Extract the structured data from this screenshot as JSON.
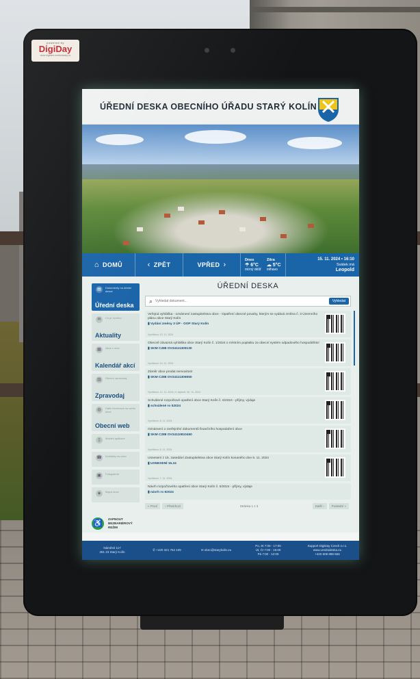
{
  "kiosk": {
    "sticker": {
      "brand_small": "powered by",
      "brand": "DigiDay",
      "brand_sub": "www.digitalni-urednidesky.cz"
    }
  },
  "screen": {
    "title": "ÚŘEDNÍ DESKA OBECNÍHO ÚŘADU STARÝ KOLÍN",
    "nav": {
      "home": "DOMŮ",
      "back": "ZPĚT",
      "forward": "VPŘED",
      "weather_today_day": "Dnes",
      "weather_today_temp": "6°C",
      "weather_today_desc": "mírný déšť",
      "weather_tomorrow_day": "Zítra",
      "weather_tomorrow_temp": "5°C",
      "weather_tomorrow_desc": "mlhavo",
      "datetime": "15. 11. 2024 • 16:10",
      "nameday": "Svátek má",
      "name": "Leopold"
    },
    "sidebar": [
      {
        "small": "Dokumenty na úřední desce",
        "label": "Úřední deska",
        "active": true,
        "icon": "document-icon"
      },
      {
        "small": "Co je nového",
        "label": "Aktuality",
        "active": false,
        "icon": "news-icon"
      },
      {
        "small": "Akce v obci",
        "label": "Kalendář akcí",
        "active": false,
        "icon": "calendar-icon"
      },
      {
        "small": "Obecní zpravodaj",
        "label": "Zpravodaj",
        "active": false,
        "icon": "newsletter-icon"
      },
      {
        "small": "Další informace na webu obce",
        "label": "Obecní web",
        "active": false,
        "icon": "globe-icon"
      },
      {
        "small": "Mobilní aplikace",
        "label": "",
        "active": false,
        "icon": "mobile-icon"
      },
      {
        "small": "Kontakty na obec",
        "label": "",
        "active": false,
        "icon": "contact-icon"
      },
      {
        "small": "Fotogalerie",
        "label": "",
        "active": false,
        "icon": "gallery-icon"
      },
      {
        "small": "Mapa obce",
        "label": "",
        "active": false,
        "icon": "map-icon"
      }
    ],
    "accessibility": "ZAPNOUT BEZBARIÉROVÝ REŽIM",
    "main": {
      "title": "ÚŘEDNÍ DESKA",
      "search_placeholder": "Vyhledat dokument...",
      "search_button": "Vyhledat",
      "documents": [
        {
          "title": "Veřejná vyhláška - oznámení zastupitelstva obce - Opatření obecné povahy, kterým se vydává změna č. 3 Územního plánu obce Starý Kolín",
          "file": "Vydání změny 3 ÚP - OOP Starý Kolín",
          "date": "Vyvěšeno: 13. 11. 2024"
        },
        {
          "title": "Obecně závazná vyhláška obce Starý Kolín č. 1/2024 o místním poplatku za obecní systém odpadového hospodářství",
          "file": "SKM C288 OV24111309130",
          "date": "Vyvěšeno: 13. 11. 2024"
        },
        {
          "title": "Záměr obce prodat nemovitost",
          "file": "SKM C288 OV24111306550",
          "date": "Vyvěšeno: 12. 11. 2024 | K sejmutí: 30. 11. 2024"
        },
        {
          "title": "Schválené rozpočtové opatření obce Starý Kolín č. 6/2024 - příjmy, výdaje",
          "file": "schválené ro 52024",
          "date": "Vyvěšeno: 8. 11. 2024"
        },
        {
          "title": "Oznámení o zveřejnění dokumentů finančního hospodaření obce",
          "file": "SKM C288 OV24110810450",
          "date": "Vyvěšeno: 8. 11. 2024"
        },
        {
          "title": "Usnesení z 15. zasedání Zastupitelstva obce Starý Kolín konaného dne 6. 11. 2024",
          "file": "USNESENÍ 15.24",
          "date": "Vyvěšeno: 7. 11. 2024"
        },
        {
          "title": "Návrh rozpočtového opatření obce Starý Kolín č. 6/2024 - příjmy, výdaje",
          "file": "návrh ro 62024",
          "date": ""
        }
      ],
      "pager": {
        "first": "« První",
        "prev": "‹ Předchozí",
        "page": "Stránka 1 z 3",
        "next": "Další ›",
        "last": "Poslední »"
      }
    },
    "footer": {
      "address_1": "Náměstí 117",
      "address_2": "281 23 Starý Kolín",
      "phone": "+420 321 764 109",
      "email": "obec@starykolin.eu",
      "hours_1": "Po, St 7:00 - 17:00",
      "hours_2": "Út, Čt 7:00 - 15:00",
      "hours_3": "Pá 7:00 - 12:00",
      "support_1": "Support DigiDay Czech s.r.o.",
      "support_2": "www.urednideska.eu",
      "support_3": "+420 608 888 666"
    }
  },
  "colors": {
    "accent": "#1a64a8",
    "footer": "#1a4f8a",
    "accessibility": "#2a9d4b",
    "bezel": "#141516"
  }
}
